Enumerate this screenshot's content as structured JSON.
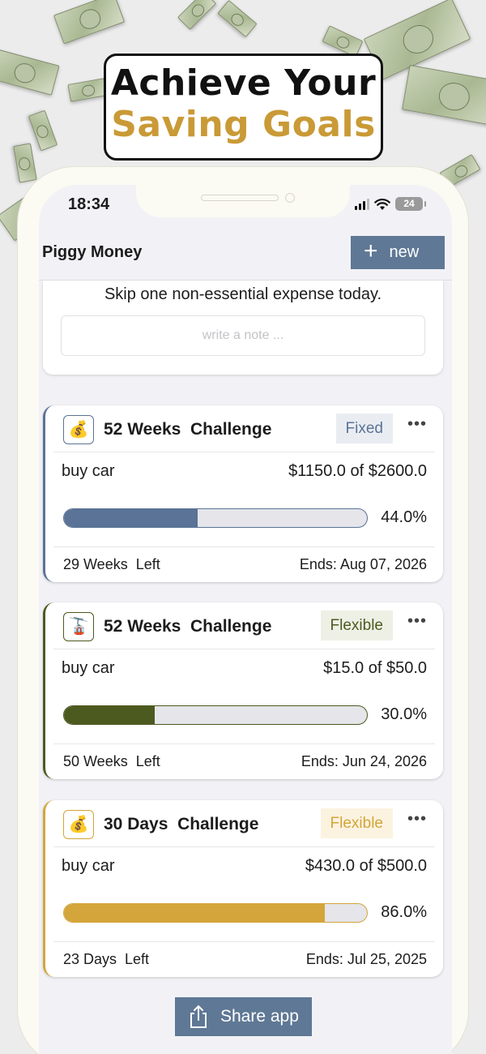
{
  "banner": {
    "line1": "Achieve Your",
    "line2": "Saving Goals"
  },
  "status_bar": {
    "time": "18:34",
    "battery": "24"
  },
  "header": {
    "app_title": "Piggy Money",
    "new_button_label": "new",
    "new_button_icon": "plus-icon"
  },
  "tip_card": {
    "text": "Skip one non-essential expense today.",
    "note_placeholder": "write a note ..."
  },
  "challenges": [
    {
      "icon": "money-bag-icon",
      "title": "52 Weeks  Challenge",
      "badge": "Fixed",
      "goal_name": "buy car",
      "amount": "$1150.0 of $2600.0",
      "progress": 0.44,
      "percent_label": "44.0%",
      "time_left": "29 Weeks  Left",
      "ends": "Ends: Aug 07, 2026",
      "accent": "#5a7396",
      "badge_bg": "#e9edf2",
      "badge_color": "#5a7396"
    },
    {
      "icon": "cable-car-icon",
      "title": "52 Weeks  Challenge",
      "badge": "Flexible",
      "goal_name": "buy car",
      "amount": "$15.0 of $50.0",
      "progress": 0.3,
      "percent_label": "30.0%",
      "time_left": "50 Weeks  Left",
      "ends": "Ends: Jun 24, 2026",
      "accent": "#4c5a20",
      "badge_bg": "#eef0e6",
      "badge_color": "#4c5a20"
    },
    {
      "icon": "money-bag-icon",
      "title": "30 Days  Challenge",
      "badge": "Flexible",
      "goal_name": "buy car",
      "amount": "$430.0 of $500.0",
      "progress": 0.86,
      "percent_label": "86.0%",
      "time_left": "23 Days  Left",
      "ends": "Ends: Jul 25, 2025",
      "accent": "#d4a53a",
      "badge_bg": "#fbf3e0",
      "badge_color": "#d4a53a"
    }
  ],
  "footer": {
    "share_label": "Share app",
    "share_icon": "share-icon"
  }
}
